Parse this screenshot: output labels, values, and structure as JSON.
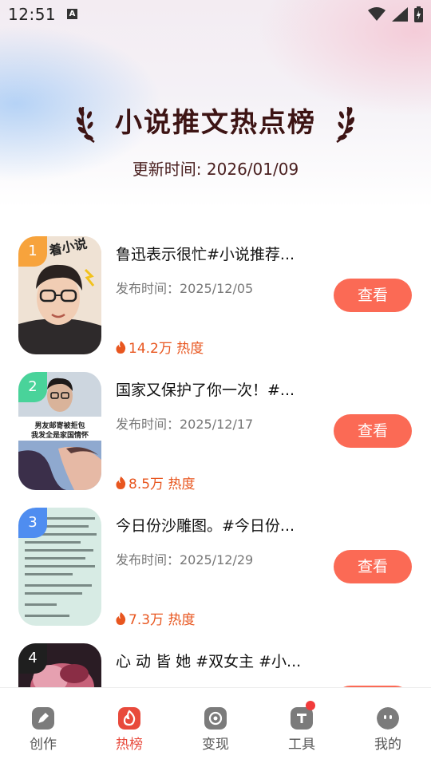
{
  "status_bar": {
    "time": "12:51"
  },
  "header": {
    "title": "小说推文热点榜",
    "update_time": "更新时间: 2026/01/09"
  },
  "items": [
    {
      "rank": "1",
      "title": "鲁迅表示很忙#小说推荐...",
      "date": "发布时间：2025/12/05",
      "heat": "14.2万 热度",
      "button": "查看",
      "rank_color": "#f7a33c"
    },
    {
      "rank": "2",
      "title": "国家又保护了你一次！#...",
      "date": "发布时间：2025/12/17",
      "heat": "8.5万 热度",
      "button": "查看",
      "rank_color": "#49d39a"
    },
    {
      "rank": "3",
      "title": "今日份沙雕图。#今日份...",
      "date": "发布时间：2025/12/29",
      "heat": "7.3万 热度",
      "button": "查看",
      "rank_color": "#4f8df0"
    },
    {
      "rank": "4",
      "title": "心 动 皆 她 #双女主 #小...",
      "rank_color": "#1f1f1f"
    }
  ],
  "thumb_text": {
    "item1": "着小说",
    "item2_a": "男友邮寄被拒包",
    "item2_b": "我发全是家国情怀"
  },
  "nav": [
    {
      "label": "创作",
      "icon": "pen-icon",
      "active": false
    },
    {
      "label": "热榜",
      "icon": "flame-icon",
      "active": true
    },
    {
      "label": "变现",
      "icon": "coin-icon",
      "active": false
    },
    {
      "label": "工具",
      "icon": "toolbox-icon",
      "active": false,
      "badge": true
    },
    {
      "label": "我的",
      "icon": "profile-icon",
      "active": false
    }
  ],
  "colors": {
    "accent": "#fb6a55",
    "heat": "#e8561f",
    "title": "#3d1414",
    "nav_active": "#e84a3c"
  }
}
